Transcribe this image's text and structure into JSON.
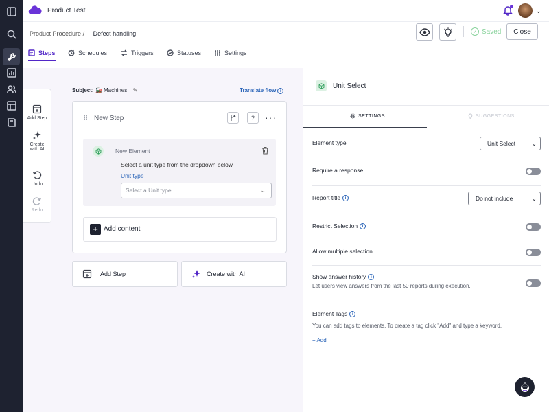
{
  "app": {
    "title": "Product Test"
  },
  "breadcrumb": {
    "parent": "Product Procedure",
    "separator": "/",
    "current": "Defect handling"
  },
  "header": {
    "saved_label": "Saved",
    "close_label": "Close"
  },
  "tabs": [
    {
      "label": "Steps",
      "icon": "steps-icon",
      "active": true
    },
    {
      "label": "Schedules",
      "icon": "schedule-icon"
    },
    {
      "label": "Triggers",
      "icon": "triggers-icon"
    },
    {
      "label": "Statuses",
      "icon": "status-icon"
    },
    {
      "label": "Settings",
      "icon": "sliders-icon"
    }
  ],
  "tools": {
    "add_step": "Add Step",
    "create_ai_line1": "Create",
    "create_ai_line2": "with AI",
    "undo": "Undo",
    "redo": "Redo"
  },
  "canvas": {
    "subject_label": "Subject:",
    "subject_value": "Machines",
    "translate_label": "Translate flow"
  },
  "step": {
    "title": "New Step",
    "element": {
      "title": "New Element",
      "description": "Select a unit type from the dropdown below",
      "link_label": "Unit type",
      "select_placeholder": "Select a Unit type"
    },
    "add_content_label": "Add content"
  },
  "bottom_buttons": {
    "add_step": "Add Step",
    "create_ai": "Create with AI"
  },
  "panel": {
    "title": "Unit Select",
    "tab_settings": "SETTINGS",
    "tab_suggestions": "SUGGESTIONS",
    "element_type_label": "Element type",
    "element_type_value": "Unit Select",
    "require_response_label": "Require a response",
    "report_title_label": "Report title",
    "report_title_value": "Do not include",
    "restrict_selection_label": "Restrict Selection",
    "allow_multiple_label": "Allow multiple selection",
    "show_history_label": "Show answer history",
    "show_history_desc": "Let users view answers from the last 50 reports during execution.",
    "tags_label": "Element Tags",
    "tags_desc": "You can add tags to elements. To create a tag click \"Add\" and type a keyword.",
    "tags_add": "+ Add"
  },
  "colors": {
    "accent": "#5227c7",
    "link": "#2a64b8",
    "rail": "#1e2230",
    "success": "#8ad39d"
  }
}
